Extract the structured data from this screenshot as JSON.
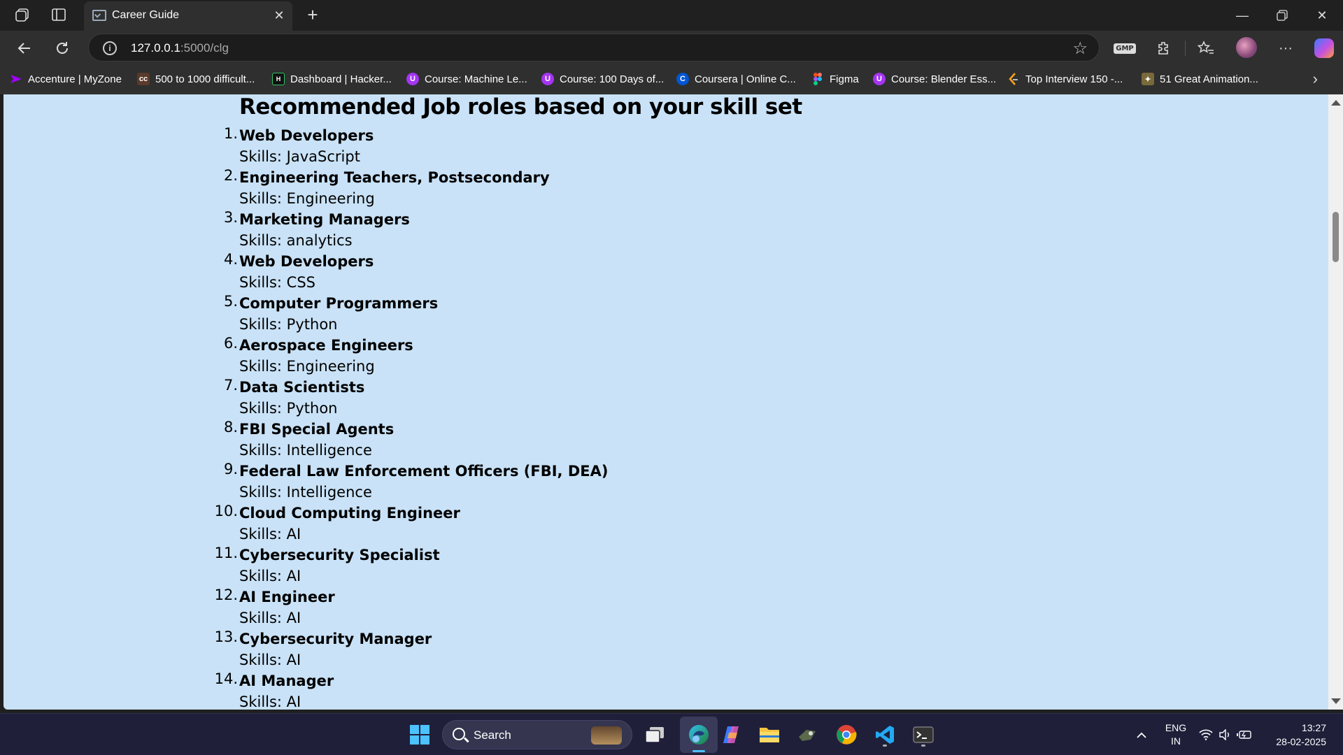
{
  "browser": {
    "tab_title": "Career Guide",
    "url_host": "127.0.0.1",
    "url_path": ":5000/clg",
    "bookmarks": [
      {
        "label": "Accenture | MyZone",
        "icon": "accenture-icon",
        "color": "#a100ff"
      },
      {
        "label": "500 to 1000 difficult...",
        "icon": "cc-icon",
        "color": "#333333"
      },
      {
        "label": "Dashboard | Hacker...",
        "icon": "hackerrank-icon",
        "color": "#111111"
      },
      {
        "label": "Course: Machine Le...",
        "icon": "udemy-icon",
        "color": "#a435f0"
      },
      {
        "label": "Course: 100 Days of...",
        "icon": "udemy-icon",
        "color": "#a435f0"
      },
      {
        "label": "Coursera | Online C...",
        "icon": "coursera-icon",
        "color": "#0056d2"
      },
      {
        "label": "Figma",
        "icon": "figma-icon",
        "color": "#f24e1e"
      },
      {
        "label": "Course: Blender Ess...",
        "icon": "udemy-icon",
        "color": "#a435f0"
      },
      {
        "label": "Top Interview 150 -...",
        "icon": "leetcode-icon",
        "color": "#333333"
      },
      {
        "label": "51 Great Animation...",
        "icon": "animation-icon",
        "color": "#7a6a3a"
      }
    ],
    "gmp_label": "GMP"
  },
  "page": {
    "title": "Recommended Job roles based on your skill set",
    "roles": [
      {
        "num": "1.",
        "name": "Web Developers",
        "skills": "Skills: JavaScript"
      },
      {
        "num": "2.",
        "name": "Engineering Teachers, Postsecondary",
        "skills": "Skills: Engineering"
      },
      {
        "num": "3.",
        "name": "Marketing Managers",
        "skills": "Skills: analytics"
      },
      {
        "num": "4.",
        "name": "Web Developers",
        "skills": "Skills: CSS"
      },
      {
        "num": "5.",
        "name": "Computer Programmers",
        "skills": "Skills: Python"
      },
      {
        "num": "6.",
        "name": "Aerospace Engineers",
        "skills": "Skills: Engineering"
      },
      {
        "num": "7.",
        "name": "Data Scientists",
        "skills": "Skills: Python"
      },
      {
        "num": "8.",
        "name": "FBI Special Agents",
        "skills": "Skills: Intelligence"
      },
      {
        "num": "9.",
        "name": "Federal Law Enforcement Officers (FBI, DEA)",
        "skills": "Skills: Intelligence"
      },
      {
        "num": "10.",
        "name": "Cloud Computing Engineer",
        "skills": "Skills: AI"
      },
      {
        "num": "11.",
        "name": "Cybersecurity Specialist",
        "skills": "Skills: AI"
      },
      {
        "num": "12.",
        "name": "AI Engineer",
        "skills": "Skills: AI"
      },
      {
        "num": "13.",
        "name": "Cybersecurity Manager",
        "skills": "Skills: AI"
      },
      {
        "num": "14.",
        "name": "AI Manager",
        "skills": "Skills: AI"
      }
    ],
    "background": "#c9e2f7"
  },
  "taskbar": {
    "search_label": "Search",
    "lang_top": "ENG",
    "lang_bottom": "IN",
    "time": "13:27",
    "date": "28-02-2025"
  }
}
